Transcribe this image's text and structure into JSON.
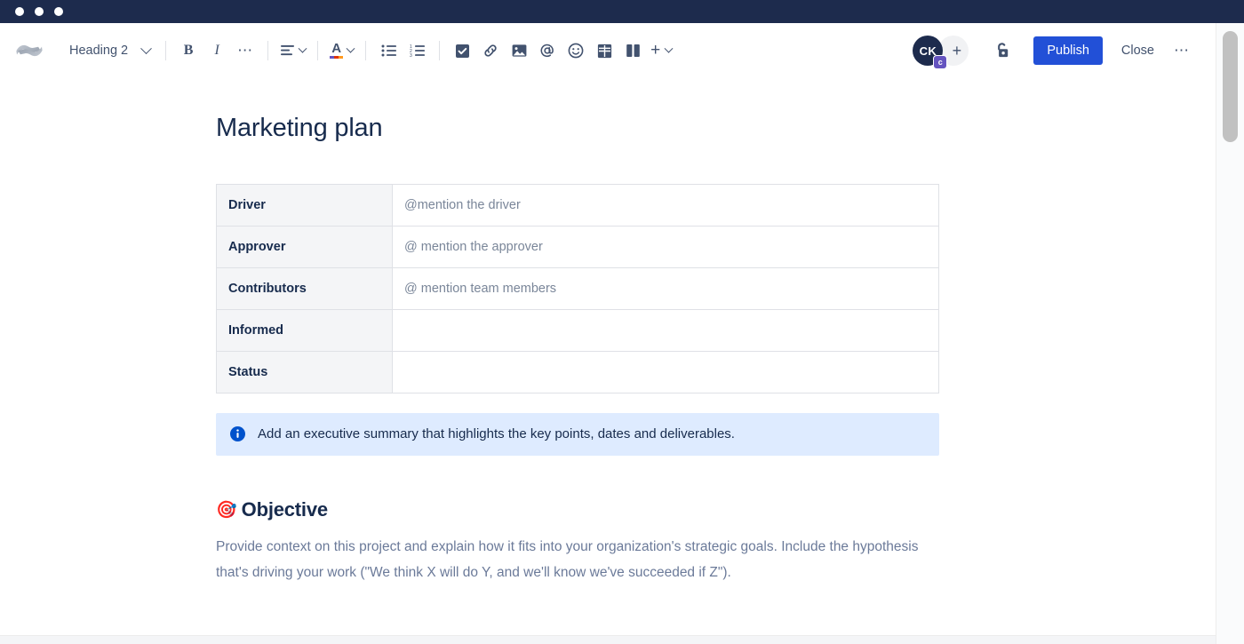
{
  "window": {
    "dots": [
      "close",
      "minimize",
      "maximize"
    ]
  },
  "toolbar": {
    "logo_name": "confluence-logo",
    "style_select": {
      "value": "Heading 2",
      "chevron": "chevron-down-icon"
    },
    "bold_label": "B",
    "italic_label": "I",
    "more_formatting_label": "•••",
    "buttons": [
      {
        "name": "bold-button",
        "label": "B"
      },
      {
        "name": "italic-button",
        "label": "I"
      },
      {
        "name": "more-formatting-button",
        "label": "•••"
      },
      {
        "name": "text-alignment-button",
        "label": ""
      },
      {
        "name": "text-color-button",
        "label": "A"
      },
      {
        "name": "bullet-list-button",
        "label": ""
      },
      {
        "name": "numbered-list-button",
        "label": ""
      },
      {
        "name": "task-list-button",
        "label": ""
      },
      {
        "name": "link-button",
        "label": ""
      },
      {
        "name": "image-button",
        "label": ""
      },
      {
        "name": "mention-button",
        "label": "@"
      },
      {
        "name": "emoji-button",
        "label": ""
      },
      {
        "name": "table-button",
        "label": ""
      },
      {
        "name": "layout-button",
        "label": ""
      },
      {
        "name": "insert-more-button",
        "label": "+"
      }
    ],
    "text_color_letter": "A",
    "mention_glyph": "@",
    "plus_glyph": "+",
    "avatar": {
      "initials": "CK",
      "badge": "c",
      "badge_color": "#6554c0",
      "bg_color": "#1d2b4d"
    },
    "add_person_glyph": "+",
    "restrictions_icon": "unlock-icon",
    "publish_label": "Publish",
    "publish_color": "#2250d7",
    "close_label": "Close",
    "more_options_label": "•••"
  },
  "document": {
    "title": "Marketing plan",
    "table": {
      "rows": [
        {
          "label": "Driver",
          "value": "@mention the driver"
        },
        {
          "label": "Approver",
          "value": "@ mention the approver"
        },
        {
          "label": "Contributors",
          "value": "@ mention team members"
        },
        {
          "label": "Informed",
          "value": ""
        },
        {
          "label": "Status",
          "value": ""
        }
      ]
    },
    "info_panel": {
      "icon": "info-icon",
      "background": "#deebff",
      "text": "Add an executive summary that highlights the key points, dates and deliverables."
    },
    "sections": [
      {
        "emoji": "🎯",
        "emoji_name": "bullseye-emoji",
        "heading": "Objective",
        "body": "Provide context on this project and explain how it fits into your organization's strategic goals. Include the hypothesis that's driving your work (\"We think X will do Y, and we'll know we've succeeded if Z\")."
      }
    ]
  },
  "scrollbar": {
    "name": "vertical-scrollbar",
    "thumb_name": "scrollbar-thumb"
  }
}
